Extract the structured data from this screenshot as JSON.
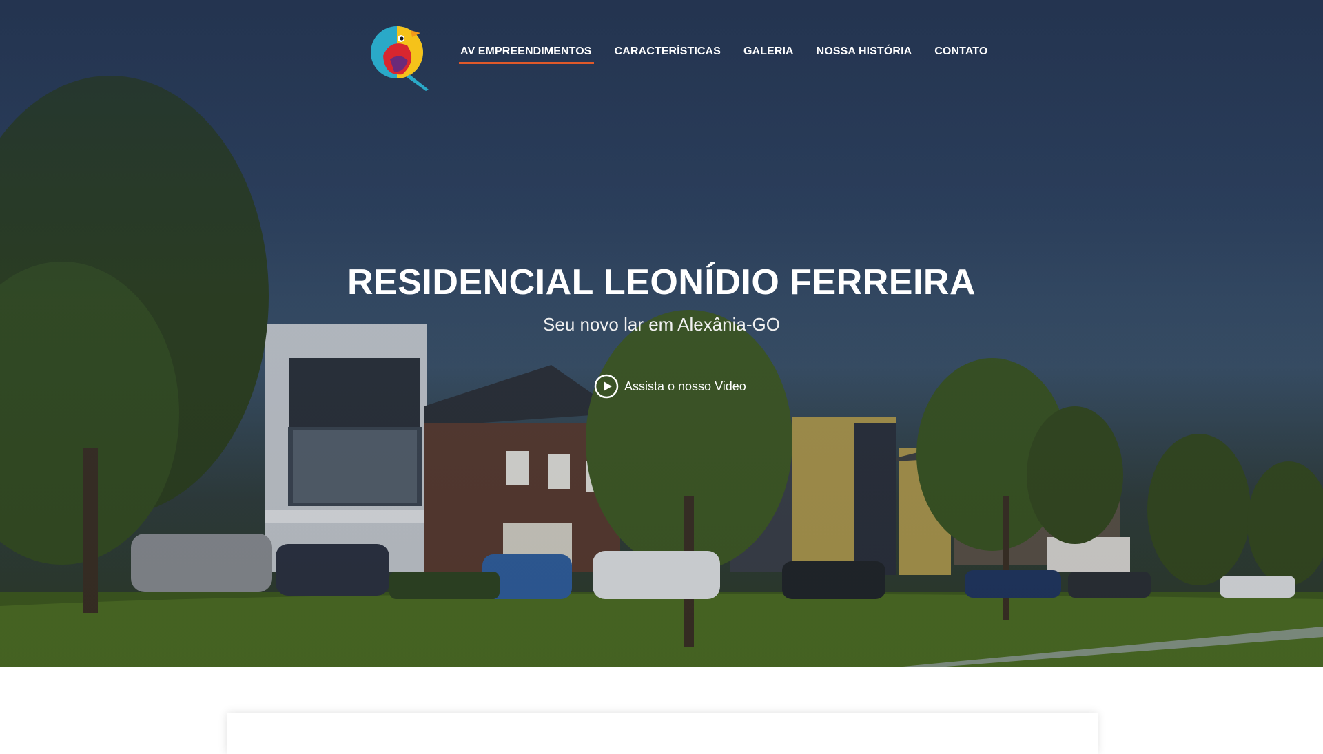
{
  "nav": {
    "items": [
      {
        "label": "AV EMPREENDIMENTOS",
        "active": true
      },
      {
        "label": "CARACTERÍSTICAS",
        "active": false
      },
      {
        "label": "GALERIA",
        "active": false
      },
      {
        "label": "NOSSA HISTÓRIA",
        "active": false
      },
      {
        "label": "CONTATO",
        "active": false
      }
    ]
  },
  "logo": {
    "icon": "bird-logo"
  },
  "hero": {
    "title": "RESIDENCIAL LEONÍDIO FERREIRA",
    "subtitle": "Seu novo lar em Alexânia-GO",
    "video_link": "Assista o nosso Video",
    "video_icon": "play-circle-icon"
  },
  "colors": {
    "accent": "#e0592a",
    "nav_text": "#ffffff",
    "hero_overlay": "#2b3d5c"
  }
}
